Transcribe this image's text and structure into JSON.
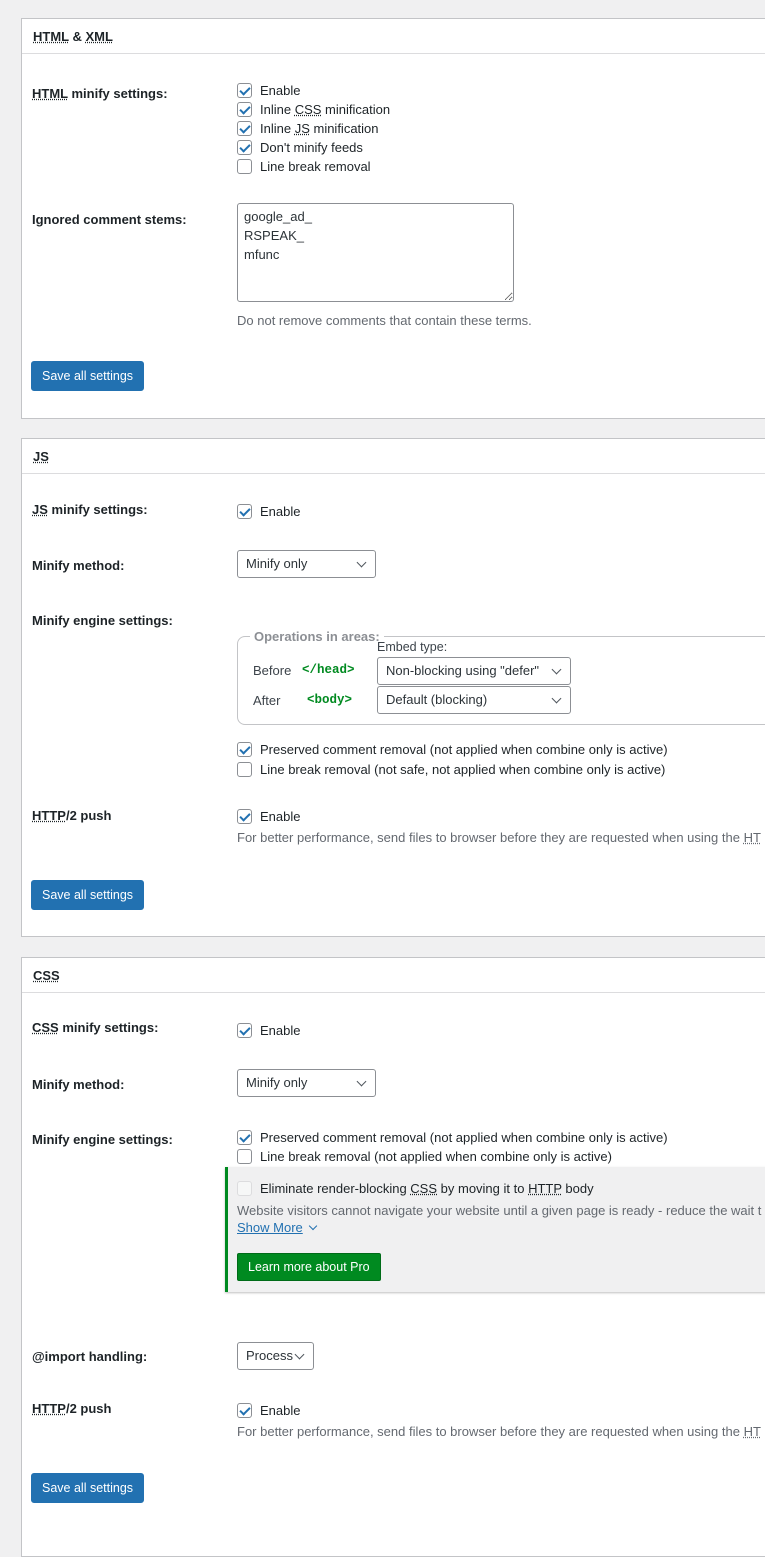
{
  "html_section": {
    "title_abbr1": "HTML",
    "title_rest": " & ",
    "title_abbr2": "XML",
    "minify_label_abbr": "HTML",
    "minify_label_rest": " minify settings:",
    "options": [
      {
        "label_pre": "Enable",
        "abbr": "",
        "label_post": "",
        "checked": true
      },
      {
        "label_pre": "Inline ",
        "abbr": "CSS",
        "label_post": " minification",
        "checked": true
      },
      {
        "label_pre": "Inline ",
        "abbr": "JS",
        "label_post": " minification",
        "checked": true
      },
      {
        "label_pre": "Don't minify feeds",
        "abbr": "",
        "label_post": "",
        "checked": true
      },
      {
        "label_pre": "Line break removal",
        "abbr": "",
        "label_post": "",
        "checked": false
      }
    ],
    "ignored_label": "Ignored comment stems:",
    "ignored_value": "google_ad_\nRSPEAK_\nmfunc",
    "ignored_desc": "Do not remove comments that contain these terms.",
    "save_label": "Save all settings"
  },
  "js_section": {
    "title": "JS",
    "minify_label_abbr": "JS",
    "minify_label_rest": " minify settings:",
    "enable_label": "Enable",
    "method_label": "Minify method:",
    "method_value": "Minify only",
    "engine_label": "Minify engine settings:",
    "ops_legend": "Operations in areas:",
    "embed_type_label": "Embed type:",
    "before_label": "Before",
    "before_tag": "</head>",
    "before_value": "Non-blocking using \"defer\"",
    "after_label": "After",
    "after_tag": "<body>",
    "after_value": "Default (blocking)",
    "preserved_label": "Preserved comment removal (not applied when combine only is active)",
    "linebreak_label": "Line break removal (not safe, not applied when combine only is active)",
    "http2_label_abbr": "HTTP",
    "http2_label_rest": "/2 push",
    "http2_enable": "Enable",
    "http2_desc_pre": "For better performance, send files to browser before they are requested when using the ",
    "http2_desc_abbr": "HT",
    "save_label": "Save all settings"
  },
  "css_section": {
    "title": "CSS",
    "minify_label_abbr": "CSS",
    "minify_label_rest": " minify settings:",
    "enable_label": "Enable",
    "method_label": "Minify method:",
    "method_value": "Minify only",
    "engine_label": "Minify engine settings:",
    "preserved_label": "Preserved comment removal (not applied when combine only is active)",
    "linebreak_label": "Line break removal (not applied when combine only is active)",
    "render_pre": "Eliminate render-blocking ",
    "render_abbr1": "CSS",
    "render_mid": " by moving it to ",
    "render_abbr2": "HTTP",
    "render_post": " body",
    "render_desc": "Website visitors cannot navigate your website until a given page is ready - reduce the wait t",
    "show_more": "Show More",
    "learn_more": "Learn more about Pro",
    "import_label": "@import handling:",
    "import_value": "Process",
    "http2_label_abbr": "HTTP",
    "http2_label_rest": "/2 push",
    "http2_enable": "Enable",
    "http2_desc_pre": "For better performance, send files to browser before they are requested when using the ",
    "http2_desc_abbr": "HT",
    "save_label": "Save all settings"
  },
  "colors": {
    "primary": "#2271b1",
    "pro_green": "#008a20",
    "page_bg": "#f0f0f1"
  }
}
